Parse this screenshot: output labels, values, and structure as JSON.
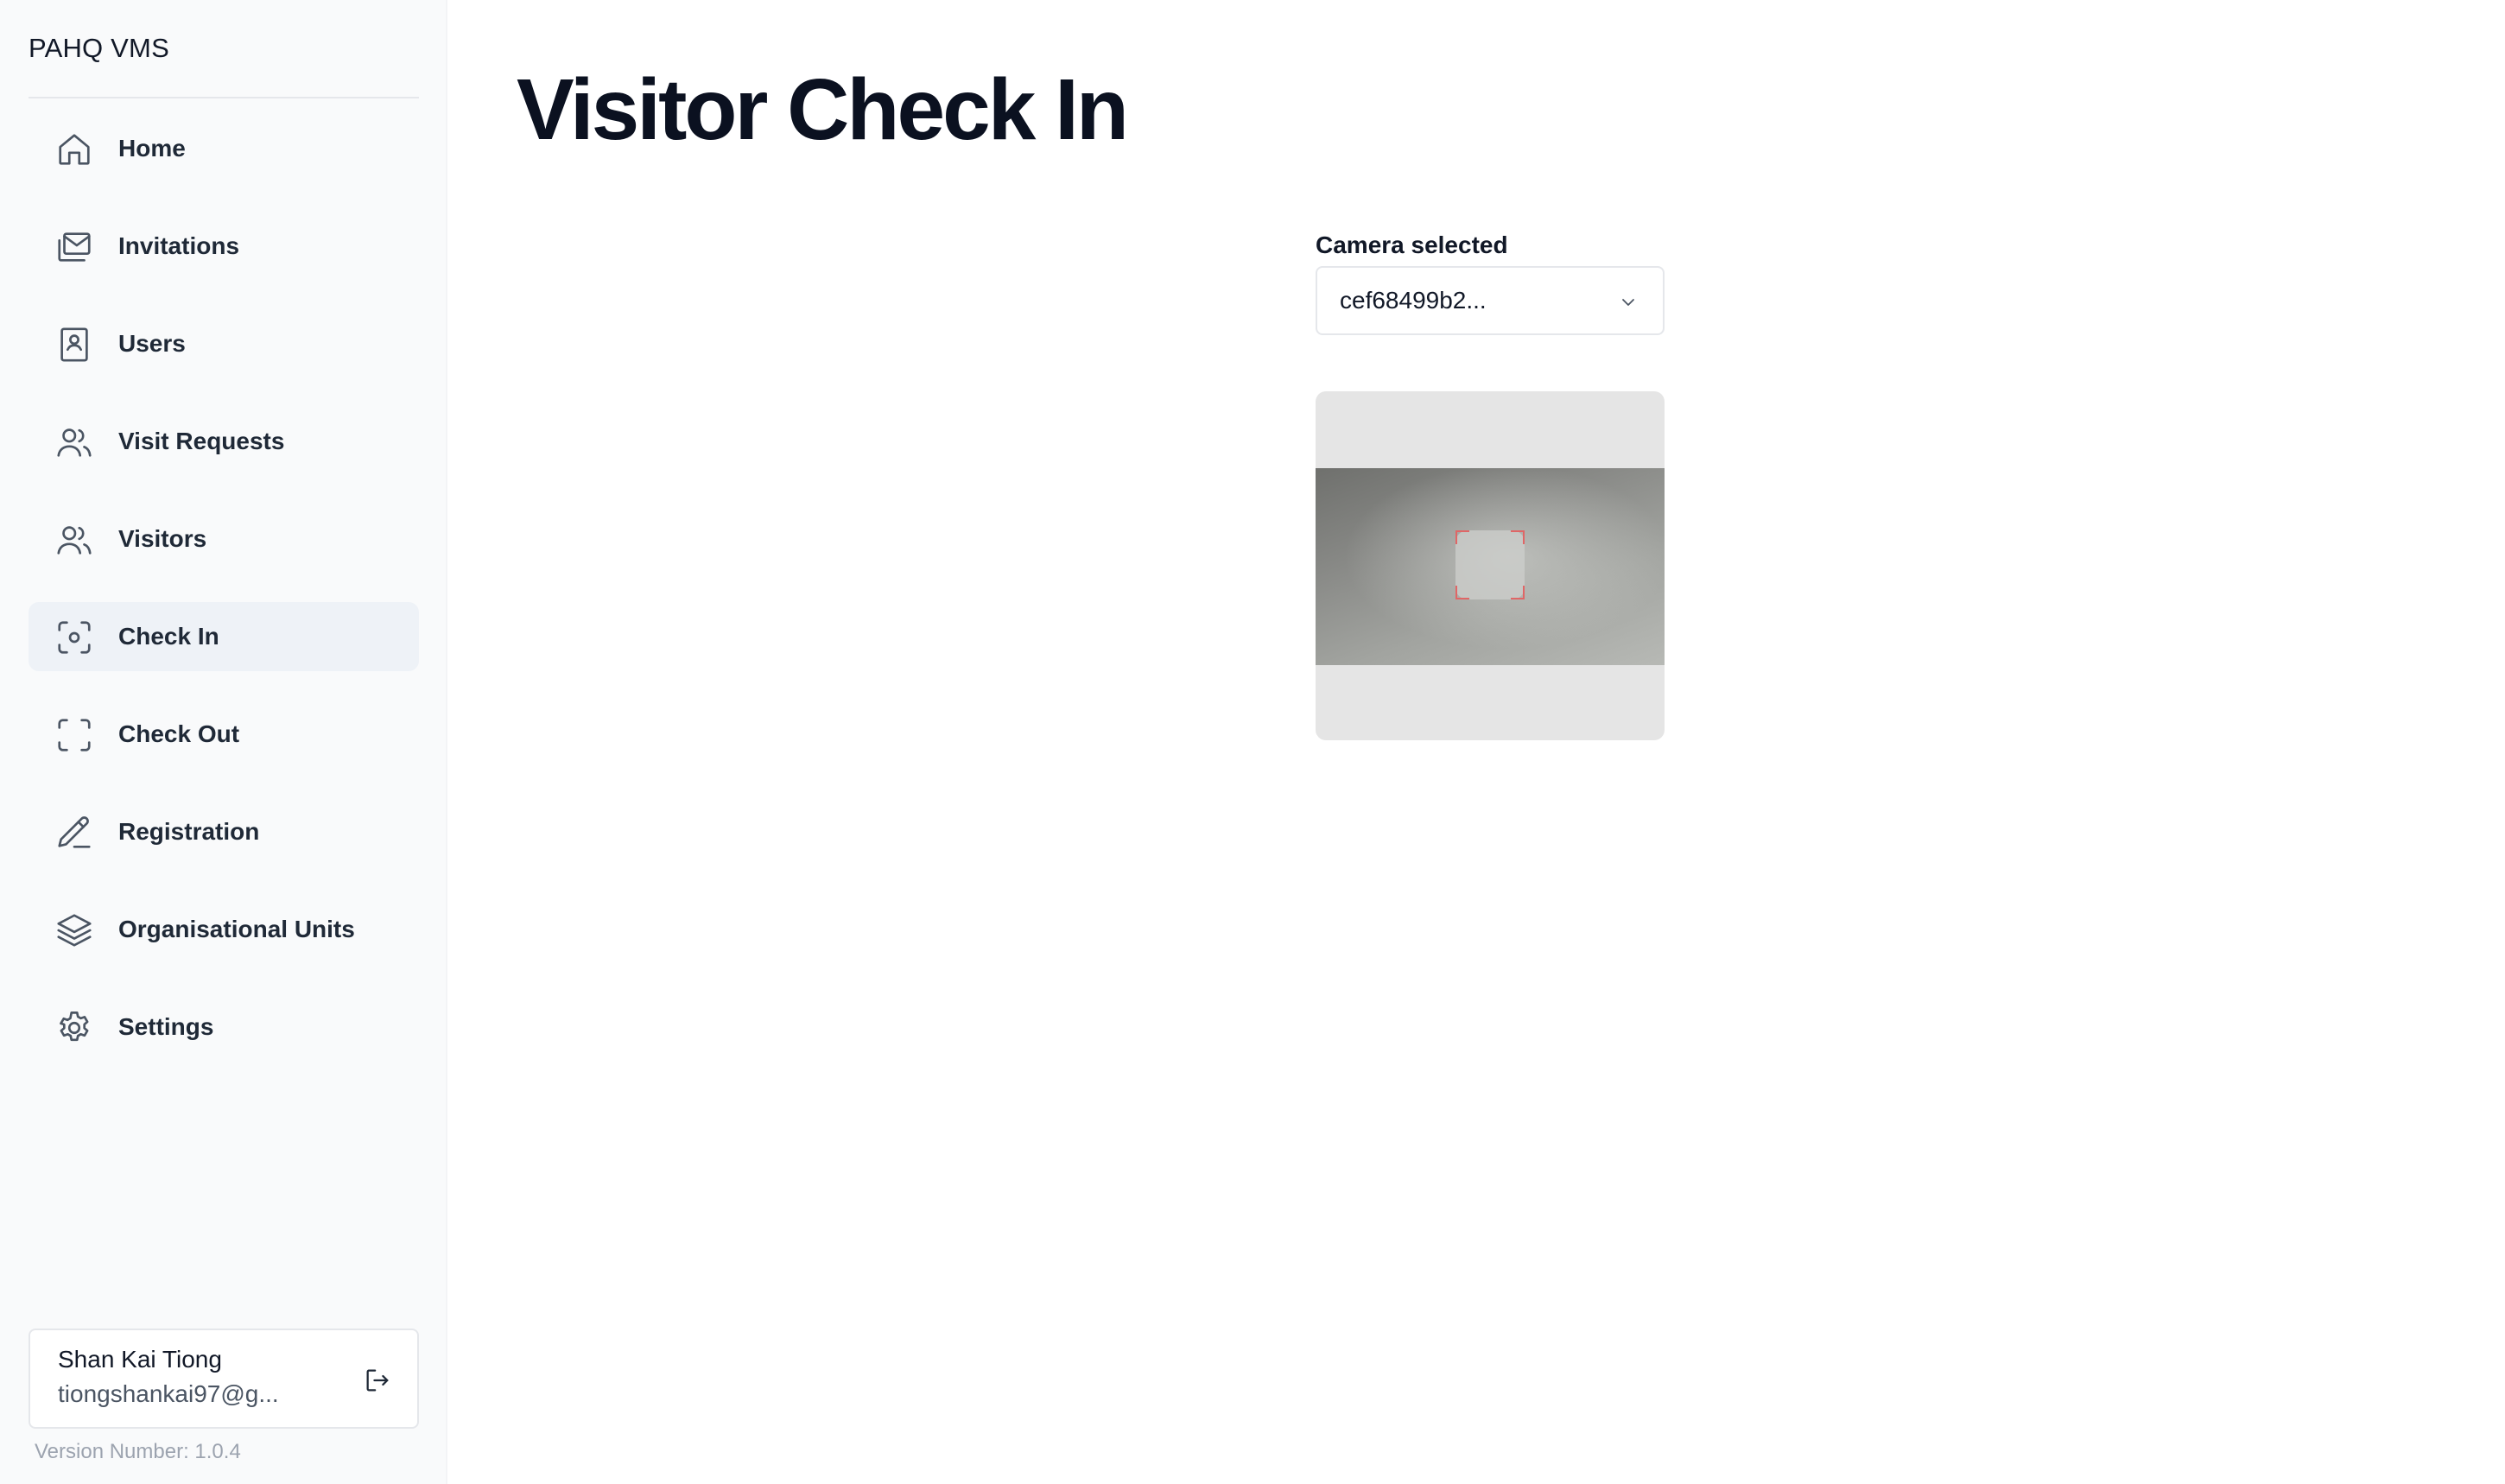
{
  "app": {
    "title": "PAHQ VMS"
  },
  "sidebar": {
    "items": [
      {
        "label": "Home",
        "icon": "home-icon",
        "active": false
      },
      {
        "label": "Invitations",
        "icon": "mail-stack-icon",
        "active": false
      },
      {
        "label": "Users",
        "icon": "contact-book-icon",
        "active": false
      },
      {
        "label": "Visit Requests",
        "icon": "users-icon",
        "active": false
      },
      {
        "label": "Visitors",
        "icon": "users-icon",
        "active": false
      },
      {
        "label": "Check In",
        "icon": "face-scan-icon",
        "active": true
      },
      {
        "label": "Check Out",
        "icon": "scan-frame-icon",
        "active": false
      },
      {
        "label": "Registration",
        "icon": "pencil-icon",
        "active": false
      },
      {
        "label": "Organisational Units",
        "icon": "layers-icon",
        "active": false
      },
      {
        "label": "Settings",
        "icon": "gear-icon",
        "active": false
      }
    ],
    "user": {
      "name": "Shan Kai Tiong",
      "email": "tiongshankai97@g..."
    },
    "version": "Version Number: 1.0.4"
  },
  "main": {
    "title": "Visitor Check In",
    "camera": {
      "label": "Camera selected",
      "selected": "cef68499b2..."
    }
  },
  "colors": {
    "sidebar_bg": "#f9fafb",
    "active_item_bg": "#eef2f7",
    "scan_corner": "#e06666"
  }
}
